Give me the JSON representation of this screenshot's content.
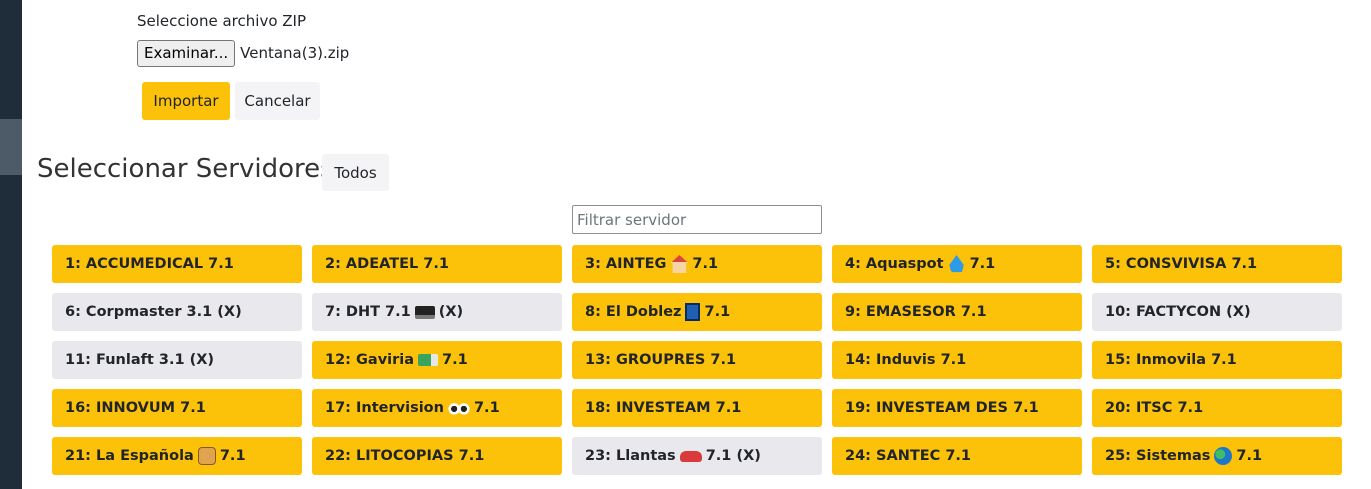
{
  "upload": {
    "label": "Seleccione archivo ZIP",
    "browse_label": "Examinar...",
    "file_name": "Ventana(3).zip"
  },
  "actions": {
    "import_label": "Importar",
    "cancel_label": "Cancelar"
  },
  "servers_section": {
    "title": "Seleccionar Servidores",
    "all_label": "Todos",
    "filter_placeholder": "Filtrar servidor",
    "filter_value": ""
  },
  "colors": {
    "selected": "#fcc109",
    "unselected": "#e9e9ed",
    "sidebar": "#1f2d3a"
  },
  "servers": [
    {
      "pre": "1: ACCUMEDICAL",
      "icon": "",
      "post": "7.1",
      "selected": true
    },
    {
      "pre": "2: ADEATEL",
      "icon": "",
      "post": "7.1",
      "selected": true
    },
    {
      "pre": "3: AINTEG",
      "icon": "house-icon",
      "post": "7.1",
      "selected": true
    },
    {
      "pre": "4: Aquaspot",
      "icon": "droplet-icon",
      "post": "7.1",
      "selected": true
    },
    {
      "pre": "5: CONSVIVISA",
      "icon": "",
      "post": "7.1",
      "selected": true
    },
    {
      "pre": "6: Corpmaster 3.1 (X)",
      "icon": "",
      "post": "",
      "selected": false
    },
    {
      "pre": "7: DHT 7.1",
      "icon": "laptop-icon",
      "post": "(X)",
      "selected": false
    },
    {
      "pre": "8: El Doblez",
      "icon": "door-icon",
      "post": "7.1",
      "selected": true
    },
    {
      "pre": "9: EMASESOR",
      "icon": "",
      "post": "7.1",
      "selected": true
    },
    {
      "pre": "10: FACTYCON (X)",
      "icon": "",
      "post": "",
      "selected": false
    },
    {
      "pre": "11: Funlaft 3.1 (X)",
      "icon": "",
      "post": "",
      "selected": false
    },
    {
      "pre": "12: Gaviria",
      "icon": "truck-icon",
      "post": "7.1",
      "selected": true
    },
    {
      "pre": "13: GROUPRES",
      "icon": "",
      "post": "7.1",
      "selected": true
    },
    {
      "pre": "14: Induvis",
      "icon": "",
      "post": "7.1",
      "selected": true
    },
    {
      "pre": "15: Inmovila",
      "icon": "",
      "post": "7.1",
      "selected": true
    },
    {
      "pre": "16: INNOVUM",
      "icon": "",
      "post": "7.1",
      "selected": true
    },
    {
      "pre": "17: Intervision",
      "icon": "eyes-icon",
      "post": "7.1",
      "selected": true
    },
    {
      "pre": "18: INVESTEAM",
      "icon": "",
      "post": "7.1",
      "selected": true
    },
    {
      "pre": "19: INVESTEAM DES",
      "icon": "",
      "post": "7.1",
      "selected": true
    },
    {
      "pre": "20: ITSC",
      "icon": "",
      "post": "7.1",
      "selected": true
    },
    {
      "pre": "21: La Española",
      "icon": "bread-icon",
      "post": "7.1",
      "selected": true
    },
    {
      "pre": "22: LITOCOPIAS",
      "icon": "",
      "post": "7.1",
      "selected": true
    },
    {
      "pre": "23: Llantas",
      "icon": "car-icon",
      "post": "7.1 (X)",
      "selected": false
    },
    {
      "pre": "24: SANTEC",
      "icon": "",
      "post": "7.1",
      "selected": true
    },
    {
      "pre": "25: Sistemas",
      "icon": "globe-icon",
      "post": "7.1",
      "selected": true
    }
  ]
}
